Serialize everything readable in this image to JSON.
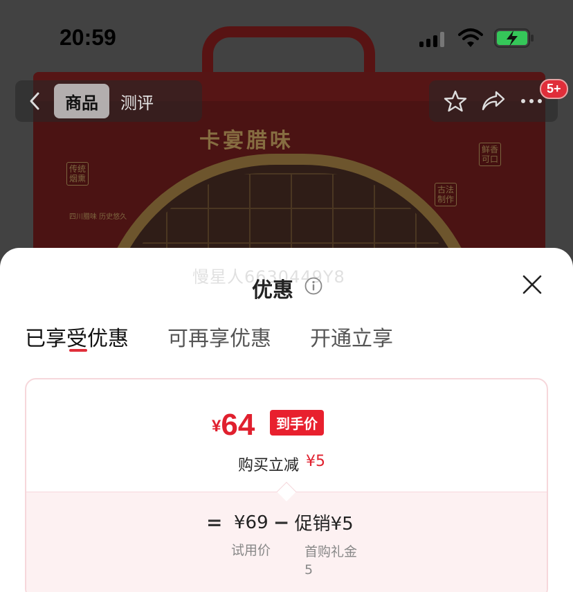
{
  "status_bar": {
    "time": "20:59"
  },
  "product_image": {
    "box_title": "卡宴腊味",
    "labels": [
      "传统\n烟熏",
      "鲜香\n可口",
      "古法\n制作"
    ],
    "caption": "四川腊味  历史悠久"
  },
  "nav": {
    "tabs": [
      {
        "label": "商品",
        "active": true
      },
      {
        "label": "测评",
        "active": false
      }
    ],
    "cart_badge": "5+"
  },
  "sheet": {
    "watermark": "慢星人6630449Y8",
    "title": "优惠",
    "tabs": [
      {
        "label": "已享受优惠",
        "active": true
      },
      {
        "label": "可再享优惠",
        "active": false
      },
      {
        "label": "开通立享",
        "active": false
      }
    ],
    "card": {
      "currency": "¥",
      "final_price": "64",
      "final_tag": "到手价",
      "reduce_label": "购买立减",
      "reduce_amount": "¥5",
      "formula": {
        "equals": "=",
        "base_price": "¥69",
        "base_label": "试用价",
        "minus": "−",
        "promo": "促销¥5",
        "promo_label": "首购礼金\n5"
      }
    }
  },
  "colors": {
    "accent": "#e0202e",
    "card_border": "#f6d7db",
    "card_bg_bottom": "#fdf1f2"
  }
}
